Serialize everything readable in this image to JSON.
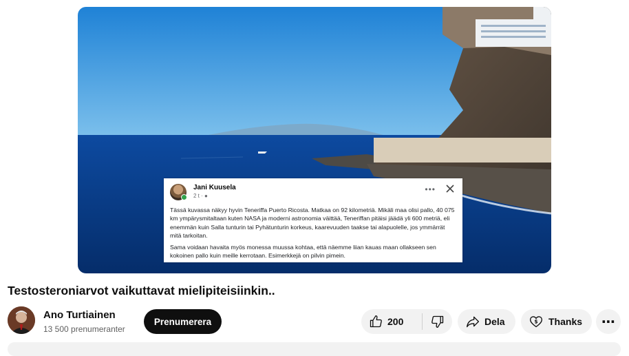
{
  "video": {
    "facebook_post": {
      "author": "Jani Kuusela",
      "meta": "2 t · ",
      "more_glyph": "•••",
      "paragraph1": "Tässä kuvassa näkyy hyvin Teneriffa Puerto Ricosta. Matkaa on 92 kilometriä. Mikäli maa olisi pallo, 40 075 km ympärysmitaltaan kuten NASA ja moderni astronomia väittää, Teneriffan pitäisi jäädä yli 600 metriä, eli enemmän kuin Salla tunturin tai Pyhätunturin korkeus, kaarevuuden taakse tai alapuolelle, jos ymmärrät mitä tarkoitan.",
      "paragraph2": "Sama voidaan havaita myös monessa muussa kohtaa, että näemme liian kauas maan ollakseen sen kokoinen pallo kuin meille kerrotaan. Esimerkkejä on pilvin pimein."
    }
  },
  "title": "Testosteroniarvot vaikuttavat mielipiteisiinkin..",
  "channel": {
    "name": "Ano Turtiainen",
    "subscribers": "13 500 prenumeranter",
    "subscribe_label": "Prenumerera"
  },
  "actions": {
    "like_count": "200",
    "share_label": "Dela",
    "thanks_label": "Thanks",
    "more_label": "⋯"
  },
  "icons": {
    "like": "thumb-up-icon",
    "dislike": "thumb-down-icon",
    "share": "share-arrow-icon",
    "thanks": "heart-dollar-icon",
    "close": "close-icon",
    "more": "more-horizontal-icon"
  },
  "colors": {
    "subscribe_bg": "#0f0f0f",
    "pill_bg": "#f2f2f2",
    "sky": "#2a8fd8",
    "sea": "#0a3f8a"
  }
}
